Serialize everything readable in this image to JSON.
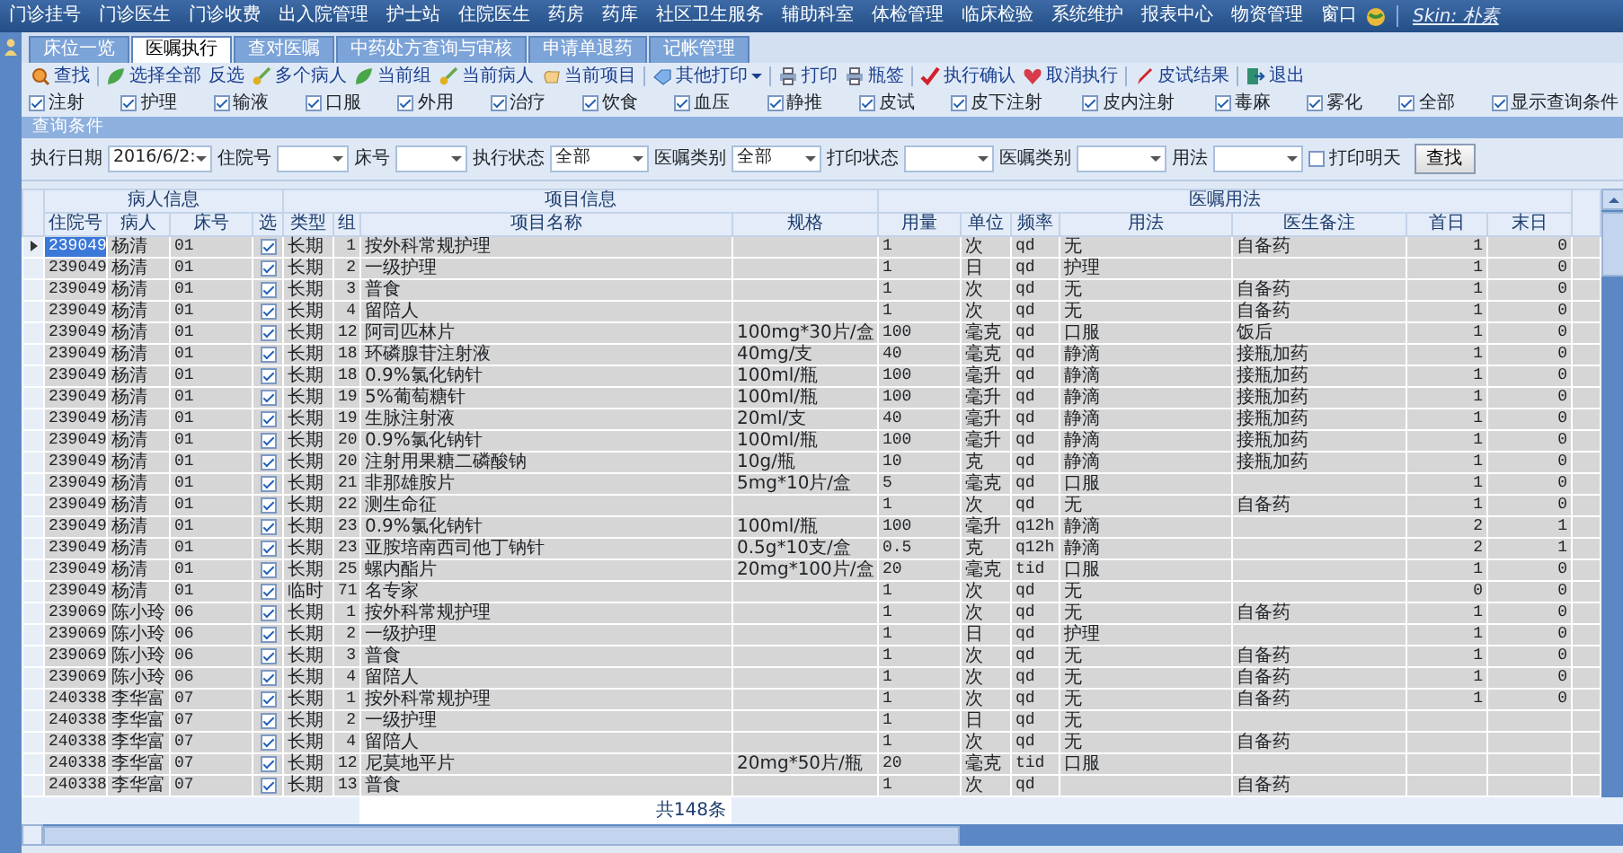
{
  "menu_bar": {
    "items": [
      "门诊挂号",
      "门诊医生",
      "门诊收费",
      "出入院管理",
      "护士站",
      "住院医生",
      "药房",
      "药库",
      "社区卫生服务",
      "辅助科室",
      "体检管理",
      "临床检验",
      "系统维护",
      "报表中心",
      "物资管理",
      "窗口"
    ],
    "skin": "Skin: 朴素"
  },
  "tabs": [
    {
      "label": "床位一览",
      "selected": false
    },
    {
      "label": "医嘱执行",
      "selected": true
    },
    {
      "label": "查对医嘱",
      "selected": false
    },
    {
      "label": "中药处方查询与审核",
      "selected": false
    },
    {
      "label": "申请单退药",
      "selected": false
    },
    {
      "label": "记帐管理",
      "selected": false
    }
  ],
  "toolbar": [
    {
      "kind": "button",
      "label": "查找"
    },
    {
      "kind": "separator"
    },
    {
      "kind": "button",
      "label": "选择全部"
    },
    {
      "kind": "button",
      "label": "反选"
    },
    {
      "kind": "button",
      "label": "多个病人"
    },
    {
      "kind": "button",
      "label": "当前组"
    },
    {
      "kind": "button",
      "label": "当前病人"
    },
    {
      "kind": "button",
      "label": "当前项目"
    },
    {
      "kind": "separator"
    },
    {
      "kind": "menu",
      "label": "其他打印"
    },
    {
      "kind": "separator"
    },
    {
      "kind": "button",
      "label": "打印"
    },
    {
      "kind": "button",
      "label": "瓶签"
    },
    {
      "kind": "separator"
    },
    {
      "kind": "button",
      "label": "执行确认"
    },
    {
      "kind": "button",
      "label": "取消执行"
    },
    {
      "kind": "separator"
    },
    {
      "kind": "button",
      "label": "皮试结果"
    },
    {
      "kind": "separator"
    },
    {
      "kind": "button",
      "label": "退出"
    }
  ],
  "filters": [
    {
      "label": "注射",
      "checked": true
    },
    {
      "label": "护理",
      "checked": true
    },
    {
      "label": "输液",
      "checked": true
    },
    {
      "label": "口服",
      "checked": true
    },
    {
      "label": "外用",
      "checked": true
    },
    {
      "label": "治疗",
      "checked": true
    },
    {
      "label": "饮食",
      "checked": true
    },
    {
      "label": "血压",
      "checked": true
    },
    {
      "label": "静推",
      "checked": true
    },
    {
      "label": "皮试",
      "checked": true
    },
    {
      "label": "皮下注射",
      "checked": true
    },
    {
      "label": "皮内注射",
      "checked": true
    },
    {
      "label": "毒麻",
      "checked": true
    },
    {
      "label": "雾化",
      "checked": true
    },
    {
      "label": "全部",
      "checked": true
    },
    {
      "label": "显示查询条件",
      "checked": true
    }
  ],
  "query": {
    "title": "查询条件",
    "fields": [
      {
        "kind": "combo",
        "label": "执行日期",
        "value": "2016/6/2:"
      },
      {
        "kind": "combo",
        "label": "住院号"
      },
      {
        "kind": "combo",
        "label": "床号"
      },
      {
        "kind": "combo",
        "label": "执行状态",
        "value": "全部"
      },
      {
        "kind": "combo",
        "label": "医嘱类别",
        "value": "全部"
      },
      {
        "kind": "combo",
        "label": "打印状态"
      },
      {
        "kind": "combo",
        "label": "医嘱类别"
      },
      {
        "kind": "combo",
        "label": "用法"
      },
      {
        "kind": "checkbox",
        "label": "打印明天",
        "checked": false
      },
      {
        "kind": "button",
        "label": "查找"
      }
    ]
  },
  "table": {
    "column_groups": [
      {
        "label": "病人信息",
        "columns": [
          "住院号",
          "病人",
          "床号",
          "选"
        ]
      },
      {
        "label": "项目信息",
        "columns": [
          "类型",
          "组",
          "项目名称",
          "规格"
        ]
      },
      {
        "label": "医嘱用法",
        "columns": [
          "用量",
          "单位",
          "频率",
          "用法",
          "医生备注",
          "首日",
          "末日"
        ]
      }
    ],
    "rows": [
      {
        "selected": true,
        "id": "239049",
        "patient": "杨清",
        "bed": "01",
        "checked": true,
        "type": "长期",
        "group": "1",
        "item": "按外科常规护理",
        "dose": "1",
        "unit": "次",
        "freq": "qd",
        "usage": "无",
        "note": "自备药",
        "first": "1",
        "last": "0"
      },
      {
        "selected": false,
        "id": "239049",
        "patient": "杨清",
        "bed": "01",
        "checked": true,
        "type": "长期",
        "group": "2",
        "item": "一级护理",
        "dose": "1",
        "unit": "日",
        "freq": "qd",
        "usage": "护理",
        "first": "1",
        "last": "0"
      },
      {
        "selected": false,
        "id": "239049",
        "patient": "杨清",
        "bed": "01",
        "checked": true,
        "type": "长期",
        "group": "3",
        "item": "普食",
        "dose": "1",
        "unit": "次",
        "freq": "qd",
        "usage": "无",
        "note": "自备药",
        "first": "1",
        "last": "0"
      },
      {
        "selected": false,
        "id": "239049",
        "patient": "杨清",
        "bed": "01",
        "checked": true,
        "type": "长期",
        "group": "4",
        "item": "留陪人",
        "dose": "1",
        "unit": "次",
        "freq": "qd",
        "usage": "无",
        "note": "自备药",
        "first": "1",
        "last": "0"
      },
      {
        "selected": false,
        "id": "239049",
        "patient": "杨清",
        "bed": "01",
        "checked": true,
        "type": "长期",
        "group": "12",
        "item": "阿司匹林片",
        "spec": "100mg*30片/盒",
        "dose": "100",
        "unit": "毫克",
        "freq": "qd",
        "usage": "口服",
        "note": "饭后",
        "first": "1",
        "last": "0"
      },
      {
        "selected": false,
        "id": "239049",
        "patient": "杨清",
        "bed": "01",
        "checked": true,
        "type": "长期",
        "group": "18",
        "item": "环磷腺苷注射液",
        "spec": "40mg/支",
        "dose": "40",
        "unit": "毫克",
        "freq": "qd",
        "usage": "静滴",
        "note": "接瓶加药",
        "first": "1",
        "last": "0"
      },
      {
        "selected": false,
        "id": "239049",
        "patient": "杨清",
        "bed": "01",
        "checked": true,
        "type": "长期",
        "group": "18",
        "item": "0.9%氯化钠针",
        "spec": "100ml/瓶",
        "dose": "100",
        "unit": "毫升",
        "freq": "qd",
        "usage": "静滴",
        "note": "接瓶加药",
        "first": "1",
        "last": "0"
      },
      {
        "selected": false,
        "id": "239049",
        "patient": "杨清",
        "bed": "01",
        "checked": true,
        "type": "长期",
        "group": "19",
        "item": "5%葡萄糖针",
        "spec": "100ml/瓶",
        "dose": "100",
        "unit": "毫升",
        "freq": "qd",
        "usage": "静滴",
        "note": "接瓶加药",
        "first": "1",
        "last": "0"
      },
      {
        "selected": false,
        "id": "239049",
        "patient": "杨清",
        "bed": "01",
        "checked": true,
        "type": "长期",
        "group": "19",
        "item": "生脉注射液",
        "spec": "20ml/支",
        "dose": "40",
        "unit": "毫升",
        "freq": "qd",
        "usage": "静滴",
        "note": "接瓶加药",
        "first": "1",
        "last": "0"
      },
      {
        "selected": false,
        "id": "239049",
        "patient": "杨清",
        "bed": "01",
        "checked": true,
        "type": "长期",
        "group": "20",
        "item": "0.9%氯化钠针",
        "spec": "100ml/瓶",
        "dose": "100",
        "unit": "毫升",
        "freq": "qd",
        "usage": "静滴",
        "note": "接瓶加药",
        "first": "1",
        "last": "0"
      },
      {
        "selected": false,
        "id": "239049",
        "patient": "杨清",
        "bed": "01",
        "checked": true,
        "type": "长期",
        "group": "20",
        "item": "注射用果糖二磷酸钠",
        "spec": "10g/瓶",
        "dose": "10",
        "unit": "克",
        "freq": "qd",
        "usage": "静滴",
        "note": "接瓶加药",
        "first": "1",
        "last": "0"
      },
      {
        "selected": false,
        "id": "239049",
        "patient": "杨清",
        "bed": "01",
        "checked": true,
        "type": "长期",
        "group": "21",
        "item": "非那雄胺片",
        "spec": "5mg*10片/盒",
        "dose": "5",
        "unit": "毫克",
        "freq": "qd",
        "usage": "口服",
        "first": "1",
        "last": "0"
      },
      {
        "selected": false,
        "id": "239049",
        "patient": "杨清",
        "bed": "01",
        "checked": true,
        "type": "长期",
        "group": "22",
        "item": "测生命征",
        "dose": "1",
        "unit": "次",
        "freq": "qd",
        "usage": "无",
        "note": "自备药",
        "first": "1",
        "last": "0"
      },
      {
        "selected": false,
        "id": "239049",
        "patient": "杨清",
        "bed": "01",
        "checked": true,
        "type": "长期",
        "group": "23",
        "item": "0.9%氯化钠针",
        "spec": "100ml/瓶",
        "dose": "100",
        "unit": "毫升",
        "freq": "q12h",
        "usage": "静滴",
        "first": "2",
        "last": "1"
      },
      {
        "selected": false,
        "id": "239049",
        "patient": "杨清",
        "bed": "01",
        "checked": true,
        "type": "长期",
        "group": "23",
        "item": "亚胺培南西司他丁钠针",
        "spec": "0.5g*10支/盒",
        "dose": "0.5",
        "unit": "克",
        "freq": "q12h",
        "usage": "静滴",
        "first": "2",
        "last": "1"
      },
      {
        "selected": false,
        "id": "239049",
        "patient": "杨清",
        "bed": "01",
        "checked": true,
        "type": "长期",
        "group": "25",
        "item": "螺内酯片",
        "spec": "20mg*100片/盒",
        "dose": "20",
        "unit": "毫克",
        "freq": "tid",
        "usage": "口服",
        "first": "1",
        "last": "0"
      },
      {
        "selected": false,
        "id": "239049",
        "patient": "杨清",
        "bed": "01",
        "checked": true,
        "type": "临时",
        "group": "71",
        "item": "名专家",
        "dose": "1",
        "unit": "次",
        "freq": "qd",
        "usage": "无",
        "first": "0",
        "last": "0"
      },
      {
        "selected": false,
        "id": "239069",
        "patient": "陈小玲",
        "bed": "06",
        "checked": true,
        "type": "长期",
        "group": "1",
        "item": "按外科常规护理",
        "dose": "1",
        "unit": "次",
        "freq": "qd",
        "usage": "无",
        "note": "自备药",
        "first": "1",
        "last": "0"
      },
      {
        "selected": false,
        "id": "239069",
        "patient": "陈小玲",
        "bed": "06",
        "checked": true,
        "type": "长期",
        "group": "2",
        "item": "一级护理",
        "dose": "1",
        "unit": "日",
        "freq": "qd",
        "usage": "护理",
        "first": "1",
        "last": "0"
      },
      {
        "selected": false,
        "id": "239069",
        "patient": "陈小玲",
        "bed": "06",
        "checked": true,
        "type": "长期",
        "group": "3",
        "item": "普食",
        "dose": "1",
        "unit": "次",
        "freq": "qd",
        "usage": "无",
        "note": "自备药",
        "first": "1",
        "last": "0"
      },
      {
        "selected": false,
        "id": "239069",
        "patient": "陈小玲",
        "bed": "06",
        "checked": true,
        "type": "长期",
        "group": "4",
        "item": "留陪人",
        "dose": "1",
        "unit": "次",
        "freq": "qd",
        "usage": "无",
        "note": "自备药",
        "first": "1",
        "last": "0"
      },
      {
        "selected": false,
        "id": "240338",
        "patient": "李华富",
        "bed": "07",
        "checked": true,
        "type": "长期",
        "group": "1",
        "item": "按外科常规护理",
        "dose": "1",
        "unit": "次",
        "freq": "qd",
        "usage": "无",
        "note": "自备药",
        "first": "1",
        "last": "0"
      },
      {
        "selected": false,
        "id": "240338",
        "patient": "李华富",
        "bed": "07",
        "checked": true,
        "type": "长期",
        "group": "2",
        "item": "一级护理",
        "dose": "1",
        "unit": "日",
        "freq": "qd",
        "usage": "无"
      },
      {
        "selected": false,
        "id": "240338",
        "patient": "李华富",
        "bed": "07",
        "checked": true,
        "type": "长期",
        "group": "4",
        "item": "留陪人",
        "dose": "1",
        "unit": "次",
        "freq": "qd",
        "usage": "无",
        "note": "自备药"
      },
      {
        "selected": false,
        "id": "240338",
        "patient": "李华富",
        "bed": "07",
        "checked": true,
        "type": "长期",
        "group": "12",
        "item": "尼莫地平片",
        "spec": "20mg*50片/瓶",
        "dose": "20",
        "unit": "毫克",
        "freq": "tid",
        "usage": "口服"
      },
      {
        "selected": false,
        "id": "240338",
        "patient": "李华富",
        "bed": "07",
        "checked": true,
        "type": "长期",
        "group": "13",
        "item": "普食",
        "dose": "1",
        "unit": "次",
        "freq": "qd",
        "note": "自备药"
      }
    ],
    "total": "共148条"
  }
}
